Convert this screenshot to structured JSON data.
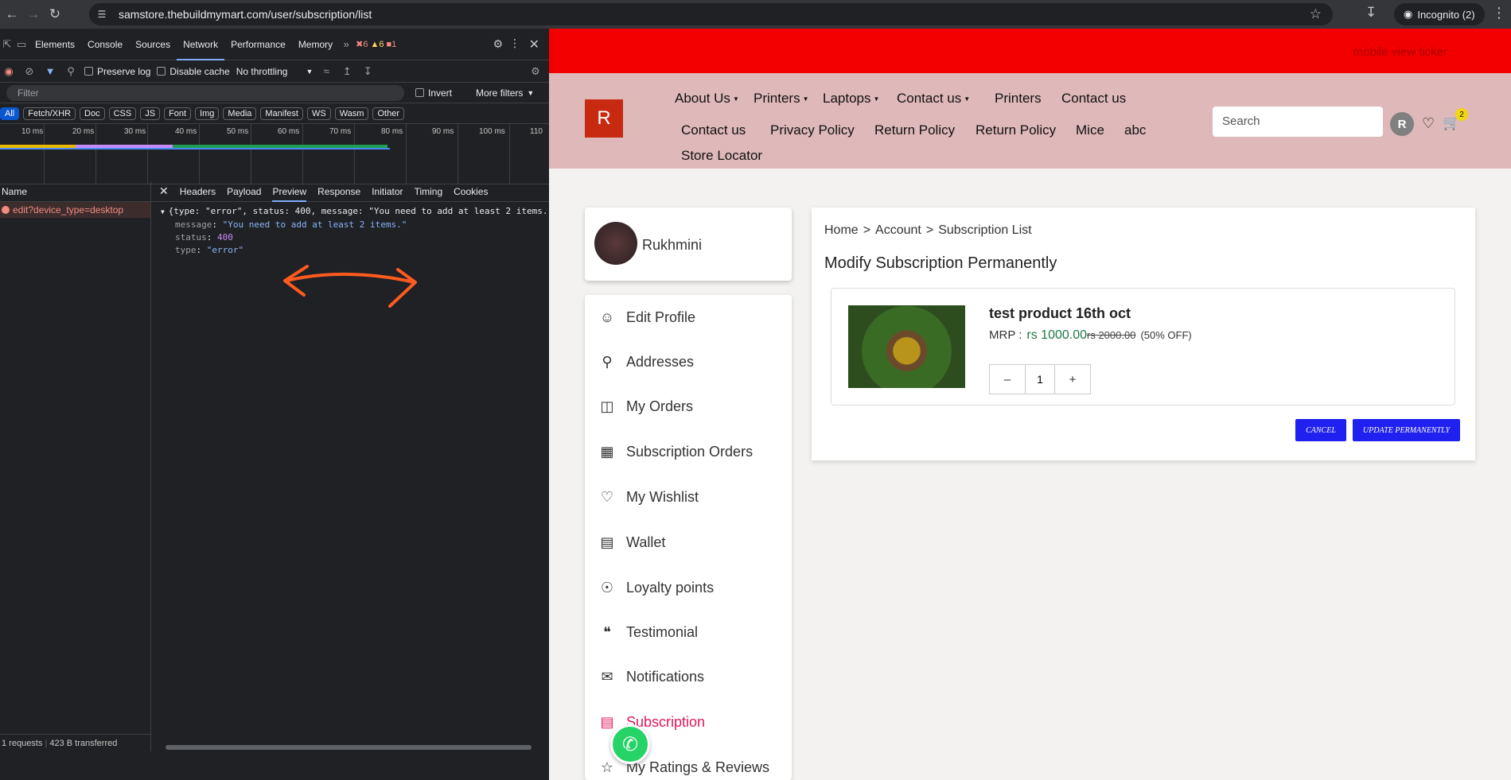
{
  "browser": {
    "url": "samstore.thebuildmymart.com/user/subscription/list",
    "incognito_label": "Incognito (2)"
  },
  "devtools": {
    "tabs": [
      "Elements",
      "Console",
      "Sources",
      "Network",
      "Performance",
      "Memory"
    ],
    "active_tab": "Network",
    "errors_count": "6",
    "warnings_count": "6",
    "issues_count": "1",
    "preserve_log": "Preserve log",
    "disable_cache": "Disable cache",
    "throttling": "No throttling",
    "filter_placeholder": "Filter",
    "invert": "Invert",
    "more_filters": "More filters",
    "type_filters": [
      "All",
      "Fetch/XHR",
      "Doc",
      "CSS",
      "JS",
      "Font",
      "Img",
      "Media",
      "Manifest",
      "WS",
      "Wasm",
      "Other"
    ],
    "timeline_ticks": [
      "10 ms",
      "20 ms",
      "30 ms",
      "40 ms",
      "50 ms",
      "60 ms",
      "70 ms",
      "80 ms",
      "90 ms",
      "100 ms",
      "110"
    ],
    "name_header": "Name",
    "request_name": "edit?device_type=desktop",
    "detail_tabs": [
      "Headers",
      "Payload",
      "Preview",
      "Response",
      "Initiator",
      "Timing",
      "Cookies"
    ],
    "active_detail_tab": "Preview",
    "preview_summary": "{type: \"error\", status: 400, message: \"You need to add at least 2 items.\"}",
    "preview_message_key": "message",
    "preview_message_val": "\"You need to add at least 2 items.\"",
    "preview_status_key": "status",
    "preview_status_val": "400",
    "preview_type_key": "type",
    "preview_type_val": "\"error\"",
    "status_requests": "1 requests",
    "status_transferred": "423 B transferred"
  },
  "site": {
    "ticker": "mobile view ticker",
    "logo": "R",
    "nav_row1": [
      {
        "label": "About Us",
        "dropdown": true
      },
      {
        "label": "Printers",
        "dropdown": true
      },
      {
        "label": "Laptops",
        "dropdown": true
      },
      {
        "label": "Contact us",
        "dropdown": true
      },
      {
        "label": "Printers",
        "dropdown": false
      },
      {
        "label": "Contact us",
        "dropdown": false
      }
    ],
    "nav_row2": [
      "Contact us",
      "Privacy Policy",
      "Return Policy",
      "Return Policy",
      "Mice",
      "abc"
    ],
    "nav_row3": [
      "Store Locator"
    ],
    "search_placeholder": "Search",
    "avatar_letter": "R",
    "cart_count": "2",
    "profile_name": "Rukhmini",
    "menu": [
      {
        "label": "Edit Profile",
        "icon": "user-icon"
      },
      {
        "label": "Addresses",
        "icon": "location-icon"
      },
      {
        "label": "My Orders",
        "icon": "orders-icon"
      },
      {
        "label": "Subscription Orders",
        "icon": "calendar-icon"
      },
      {
        "label": "My Wishlist",
        "icon": "heart-icon"
      },
      {
        "label": "Wallet",
        "icon": "wallet-icon"
      },
      {
        "label": "Loyalty points",
        "icon": "coins-icon"
      },
      {
        "label": "Testimonial",
        "icon": "quote-icon"
      },
      {
        "label": "Notifications",
        "icon": "bell-mail-icon"
      },
      {
        "label": "Subscription",
        "icon": "subscription-icon",
        "active": true
      },
      {
        "label": "My Ratings & Reviews",
        "icon": "star-icon"
      }
    ],
    "breadcrumb": [
      "Home",
      ">",
      "Account",
      ">",
      "Subscription List"
    ],
    "page_title": "Modify Subscription Permanently",
    "product": {
      "name": "test product 16th oct",
      "mrp_label": "MRP :",
      "price_now": "rs 1000.00",
      "price_old": "rs 2000.00",
      "discount": "(50% OFF)",
      "qty": "1",
      "minus": "–",
      "plus": "+"
    },
    "cancel_label": "CANCEL",
    "update_label": "UPDATE PERMANENTLY",
    "accent_color": "#2020f0",
    "active_menu_color": "#e0175a"
  }
}
